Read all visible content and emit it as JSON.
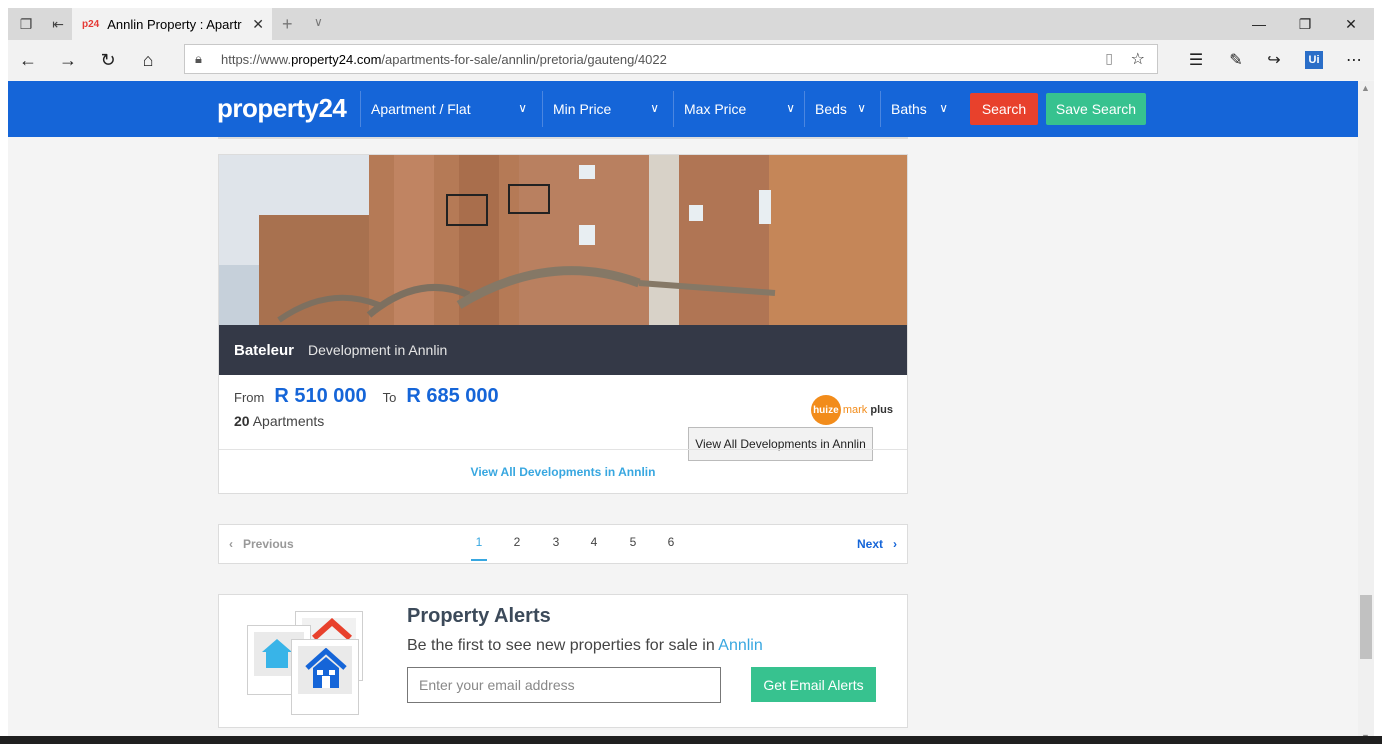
{
  "browser": {
    "tab_title": "Annlin Property : Apartr",
    "tab_favicon": "p24",
    "url_prefix": "https://www.",
    "url_host": "property24.com",
    "url_path": "/apartments-for-sale/annlin/pretoria/gauteng/4022"
  },
  "header": {
    "logo": "property24",
    "filters": [
      {
        "label": "Apartment / Flat"
      },
      {
        "label": "Min Price"
      },
      {
        "label": "Max Price"
      },
      {
        "label": "Beds"
      },
      {
        "label": "Baths"
      }
    ],
    "search_label": "Search",
    "save_search_label": "Save Search",
    "colors": {
      "bar": "#1565d8",
      "search": "#e8412c",
      "save": "#37c28f"
    }
  },
  "listing": {
    "name": "Bateleur",
    "type": "Development in Annlin",
    "from_label": "From",
    "from_price": "R 510 000",
    "to_label": "To",
    "to_price": "R 685 000",
    "unit_count": "20",
    "unit_label": "Apartments",
    "agency_logo_circle": "huize",
    "agency_logo_mark": "mark",
    "agency_logo_plus": "plus",
    "tooltip": "View All Developments in Annlin",
    "view_all": "View All Developments in Annlin"
  },
  "pager": {
    "previous": "Previous",
    "next": "Next",
    "pages": [
      "1",
      "2",
      "3",
      "4",
      "5",
      "6"
    ],
    "current": "1"
  },
  "alerts": {
    "title": "Property Alerts",
    "subtitle": "Be the first to see new properties for sale in",
    "location": "Annlin",
    "email_placeholder": "Enter your email address",
    "button": "Get Email Alerts"
  }
}
